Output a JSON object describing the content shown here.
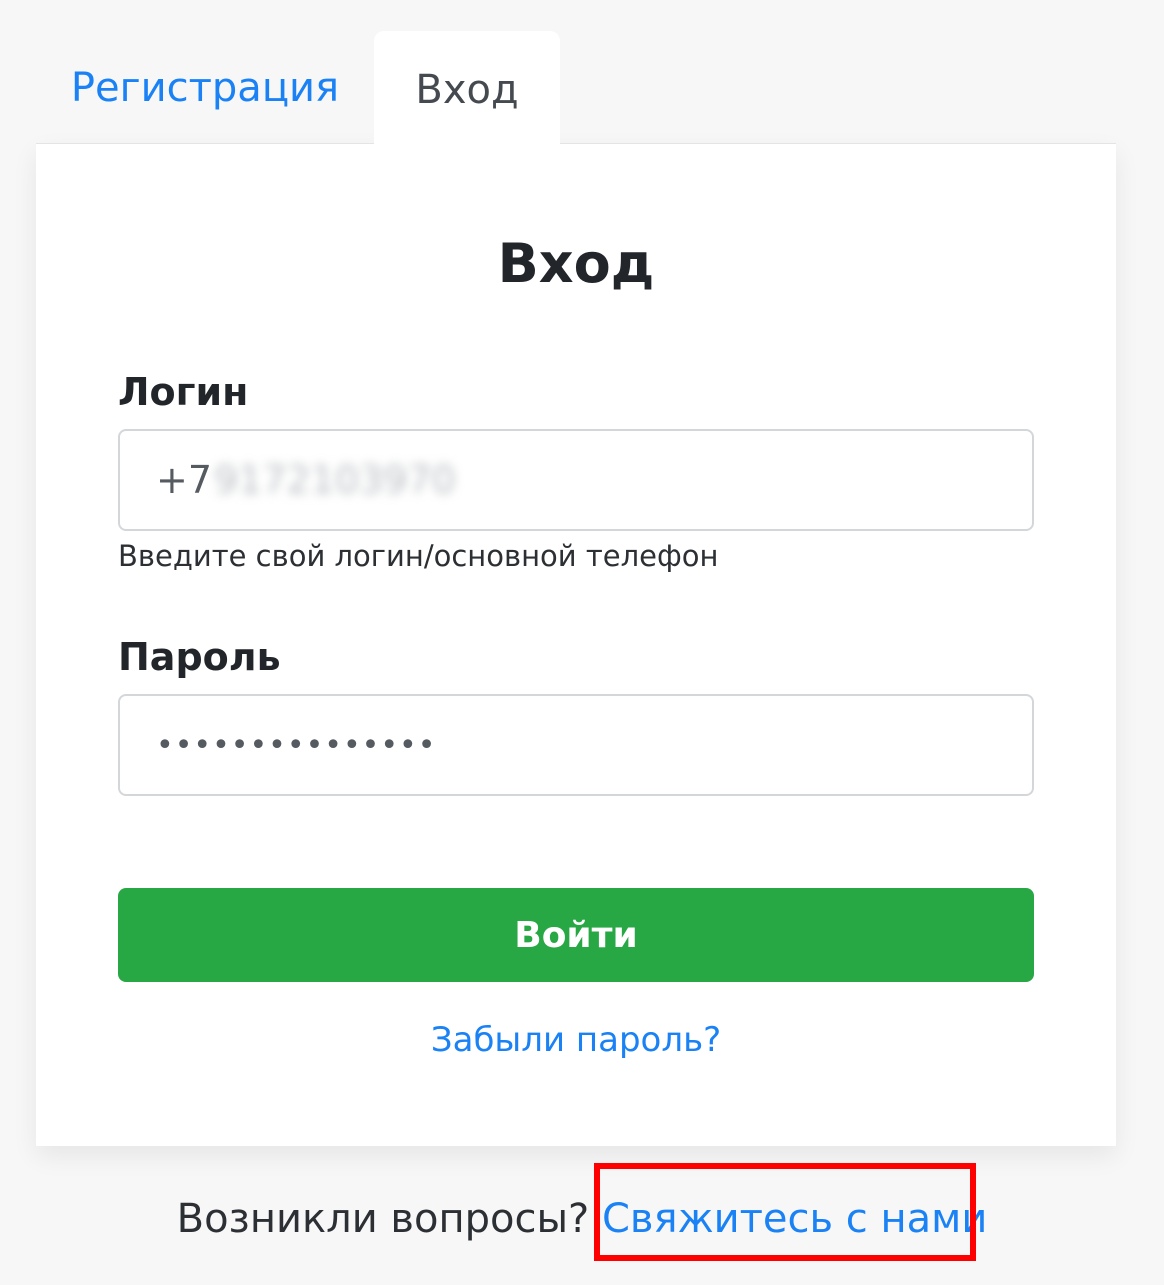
{
  "tabs": {
    "register": "Регистрация",
    "login": "Вход"
  },
  "form": {
    "title": "Вход",
    "login_label": "Логин",
    "login_prefix": "+7",
    "login_value_blurred": "9172103970",
    "login_help": "Введите свой логин/основной телефон",
    "password_label": "Пароль",
    "password_mask": "•••••••••••••••",
    "submit_label": "Войти",
    "forgot_label": "Забыли пароль?"
  },
  "footer": {
    "question": "Возникли вопросы?",
    "contact_link": "Свяжитесь с нами"
  },
  "colors": {
    "link": "#1a82f5",
    "success": "#28a745",
    "highlight": "#ff0000"
  }
}
